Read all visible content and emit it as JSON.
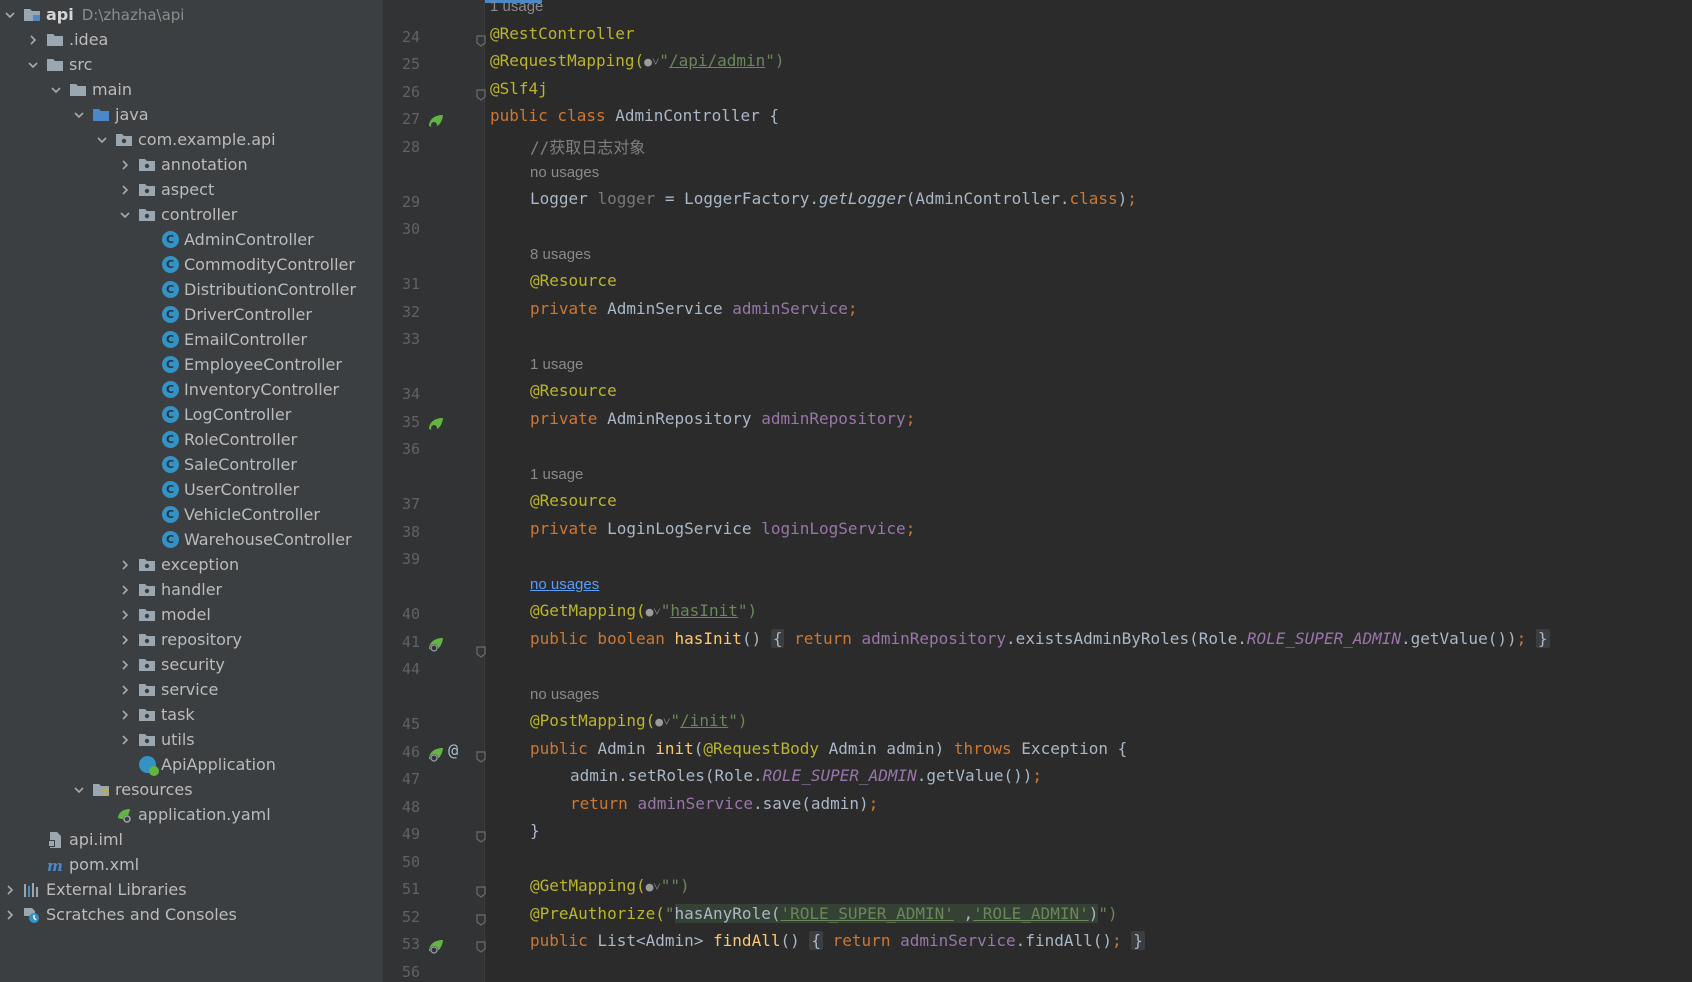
{
  "tree": [
    {
      "indent": 0,
      "arrow": "down",
      "icon": "module-folder",
      "label": "api",
      "hint": "D:\\zhazha\\api",
      "bold": true
    },
    {
      "indent": 1,
      "arrow": "right",
      "icon": "folder",
      "label": ".idea"
    },
    {
      "indent": 1,
      "arrow": "down",
      "icon": "folder",
      "label": "src"
    },
    {
      "indent": 2,
      "arrow": "down",
      "icon": "folder",
      "label": "main"
    },
    {
      "indent": 3,
      "arrow": "down",
      "icon": "source-folder",
      "label": "java"
    },
    {
      "indent": 4,
      "arrow": "down",
      "icon": "package",
      "label": "com.example.api"
    },
    {
      "indent": 5,
      "arrow": "right",
      "icon": "package",
      "label": "annotation"
    },
    {
      "indent": 5,
      "arrow": "right",
      "icon": "package",
      "label": "aspect"
    },
    {
      "indent": 5,
      "arrow": "down",
      "icon": "package",
      "label": "controller"
    },
    {
      "indent": 6,
      "arrow": "none",
      "icon": "class",
      "label": "AdminController"
    },
    {
      "indent": 6,
      "arrow": "none",
      "icon": "class",
      "label": "CommodityController"
    },
    {
      "indent": 6,
      "arrow": "none",
      "icon": "class",
      "label": "DistributionController"
    },
    {
      "indent": 6,
      "arrow": "none",
      "icon": "class",
      "label": "DriverController"
    },
    {
      "indent": 6,
      "arrow": "none",
      "icon": "class",
      "label": "EmailController"
    },
    {
      "indent": 6,
      "arrow": "none",
      "icon": "class",
      "label": "EmployeeController"
    },
    {
      "indent": 6,
      "arrow": "none",
      "icon": "class",
      "label": "InventoryController"
    },
    {
      "indent": 6,
      "arrow": "none",
      "icon": "class",
      "label": "LogController"
    },
    {
      "indent": 6,
      "arrow": "none",
      "icon": "class",
      "label": "RoleController"
    },
    {
      "indent": 6,
      "arrow": "none",
      "icon": "class",
      "label": "SaleController"
    },
    {
      "indent": 6,
      "arrow": "none",
      "icon": "class",
      "label": "UserController"
    },
    {
      "indent": 6,
      "arrow": "none",
      "icon": "class",
      "label": "VehicleController"
    },
    {
      "indent": 6,
      "arrow": "none",
      "icon": "class",
      "label": "WarehouseController"
    },
    {
      "indent": 5,
      "arrow": "right",
      "icon": "package",
      "label": "exception"
    },
    {
      "indent": 5,
      "arrow": "right",
      "icon": "package",
      "label": "handler"
    },
    {
      "indent": 5,
      "arrow": "right",
      "icon": "package",
      "label": "model"
    },
    {
      "indent": 5,
      "arrow": "right",
      "icon": "package",
      "label": "repository"
    },
    {
      "indent": 5,
      "arrow": "right",
      "icon": "package",
      "label": "security"
    },
    {
      "indent": 5,
      "arrow": "right",
      "icon": "package",
      "label": "service"
    },
    {
      "indent": 5,
      "arrow": "right",
      "icon": "package",
      "label": "task"
    },
    {
      "indent": 5,
      "arrow": "right",
      "icon": "package",
      "label": "utils"
    },
    {
      "indent": 5,
      "arrow": "none",
      "icon": "spring-class",
      "label": "ApiApplication"
    },
    {
      "indent": 3,
      "arrow": "down",
      "icon": "resources-folder",
      "label": "resources"
    },
    {
      "indent": 4,
      "arrow": "none",
      "icon": "yaml-file",
      "label": "application.yaml"
    },
    {
      "indent": 1,
      "arrow": "none",
      "icon": "iml-file",
      "label": "api.iml"
    },
    {
      "indent": 1,
      "arrow": "none",
      "icon": "maven-file",
      "label": "pom.xml"
    },
    {
      "indent": 0,
      "arrow": "right",
      "icon": "libraries",
      "label": "External Libraries"
    },
    {
      "indent": 0,
      "arrow": "right",
      "icon": "scratches",
      "label": "Scratches and Consoles"
    }
  ],
  "editor": {
    "hints": {
      "h0": "1 usage",
      "h28": "no usages",
      "h30": "8 usages",
      "h33": "1 usage",
      "h36": "1 usage",
      "h39": "no usages",
      "h44": "no usages"
    },
    "line_numbers": [
      "24",
      "25",
      "26",
      "27",
      "28",
      "29",
      "30",
      "31",
      "32",
      "33",
      "34",
      "35",
      "36",
      "37",
      "38",
      "39",
      "40",
      "41",
      "44",
      "45",
      "46",
      "47",
      "48",
      "49",
      "50",
      "51",
      "52",
      "53",
      "56"
    ],
    "code": {
      "l24": "@RestController",
      "l25_a": "@RequestMapping(",
      "l25_icon": "●˅",
      "l25_q": "\"",
      "l25_url": "/api/admin",
      "l25_e": "\")",
      "l26": "@Slf4j",
      "l27_kw": "public class ",
      "l27_rest": "AdminController {",
      "l28": "//获取日志对象",
      "l29_a": "Logger ",
      "l29_fld": "logger",
      "l29_b": " = LoggerFactory.",
      "l29_it": "getLogger",
      "l29_c": "(AdminController.",
      "l29_kw": "class",
      "l29_d": ")",
      "l29_semi": ";",
      "l31": "@Resource",
      "l32_kw": "private ",
      "l32_type": "AdminService ",
      "l32_fld": "adminService",
      "l32_semi": ";",
      "l34": "@Resource",
      "l35_kw": "private ",
      "l35_type": "AdminRepository ",
      "l35_fld": "adminRepository",
      "l35_semi": ";",
      "l37": "@Resource",
      "l38_kw": "private ",
      "l38_type": "LoginLogService ",
      "l38_fld": "loginLogService",
      "l38_semi": ";",
      "l40_a": "@GetMapping(",
      "l40_icon": "●˅",
      "l40_q": "\"",
      "l40_url": "hasInit",
      "l40_e": "\")",
      "l41_kw": "public boolean ",
      "l41_fn": "hasInit",
      "l41_a": "() ",
      "l41_ob": "{",
      "l41_ret": " return ",
      "l41_fld": "adminRepository",
      "l41_b": ".existsAdminByRoles(Role.",
      "l41_it": "ROLE_SUPER_ADMIN",
      "l41_c": ".getValue())",
      "l41_semi": ";",
      "l41_cb": "}",
      "l45_a": "@PostMapping(",
      "l45_icon": "●˅",
      "l45_q": "\"",
      "l45_url": "/init",
      "l45_e": "\")",
      "l46_kw": "public ",
      "l46_type": "Admin ",
      "l46_fn": "init",
      "l46_a": "(",
      "l46_ann": "@RequestBody",
      "l46_b": " Admin admin) ",
      "l46_kw2": "throws ",
      "l46_c": "Exception {",
      "l47_a": "admin.setRoles(Role.",
      "l47_it": "ROLE_SUPER_ADMIN",
      "l47_b": ".getValue())",
      "l47_semi": ";",
      "l48_kw": "return ",
      "l48_fld": "adminService",
      "l48_a": ".save(admin)",
      "l48_semi": ";",
      "l49": "}",
      "l51_a": "@GetMapping(",
      "l51_icon": "●˅",
      "l51_e": "\"\")",
      "l52_a": "@PreAuthorize(",
      "l52_q": "\"",
      "l52_b": "hasAnyRole(",
      "l52_s1": "'ROLE_SUPER_ADMIN'",
      "l52_c": " ,",
      "l52_s2": "'ROLE_ADMIN'",
      "l52_d": ")",
      "l52_e": "\")",
      "l53_kw": "public ",
      "l53_type": "List<Admin> ",
      "l53_fn": "findAll",
      "l53_a": "() ",
      "l53_ob": "{",
      "l53_ret": " return ",
      "l53_fld": "adminService",
      "l53_b": ".findAll()",
      "l53_semi": ";",
      "l53_cb": "}"
    }
  }
}
